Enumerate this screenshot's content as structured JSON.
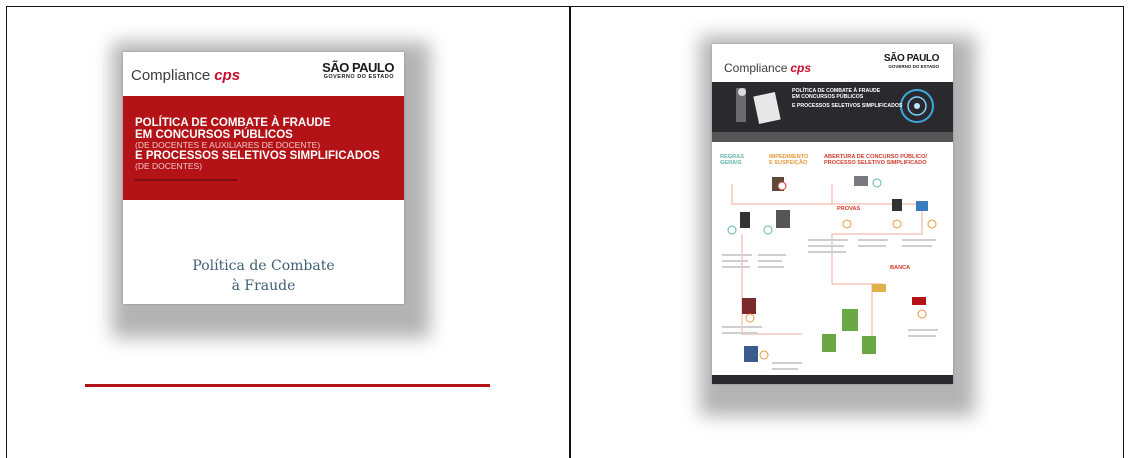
{
  "left_card": {
    "brand": "Compliance",
    "brand_mark": "cps",
    "sp_line1": "SÃO PAULO",
    "sp_line2": "GOVERNO DO ESTADO",
    "headline": [
      "POLÍTICA DE COMBATE À FRAUDE",
      "EM CONCURSOS PÚBLICOS",
      "(DE DOCENTES E AUXILIARES DE DOCENTE)",
      "E PROCESSOS SELETIVOS SIMPLIFICADOS",
      "(DE DOCENTES)"
    ],
    "caption_line1": "Política de Combate",
    "caption_line2": "à Fraude"
  },
  "right_card": {
    "brand": "Compliance",
    "brand_mark": "cps",
    "sp_line1": "SÃO PAULO",
    "sp_line2": "GOVERNO DO ESTADO",
    "headline": [
      "POLÍTICA DE COMBATE À FRAUDE",
      "EM CONCURSOS PÚBLICOS",
      "E PROCESSOS SELETIVOS SIMPLIFICADOS"
    ],
    "sections": {
      "regras": [
        "REGRAS",
        "GERAIS"
      ],
      "impedimento": [
        "IMPEDIMENTO",
        "E SUSPEIÇÃO"
      ],
      "abertura": [
        "ABERTURA DE CONCURSO PÚBLICO/",
        "PROCESSO SELETIVO SIMPLIFICADO"
      ],
      "provas": "PROVAS",
      "banca": "BANCA"
    }
  },
  "colors": {
    "accent_red": "#b31217",
    "dark_band": "#2a2a2e",
    "title_blue": "#3e5f74",
    "teal": "#5fb7a8",
    "orange": "#e79a3b"
  }
}
